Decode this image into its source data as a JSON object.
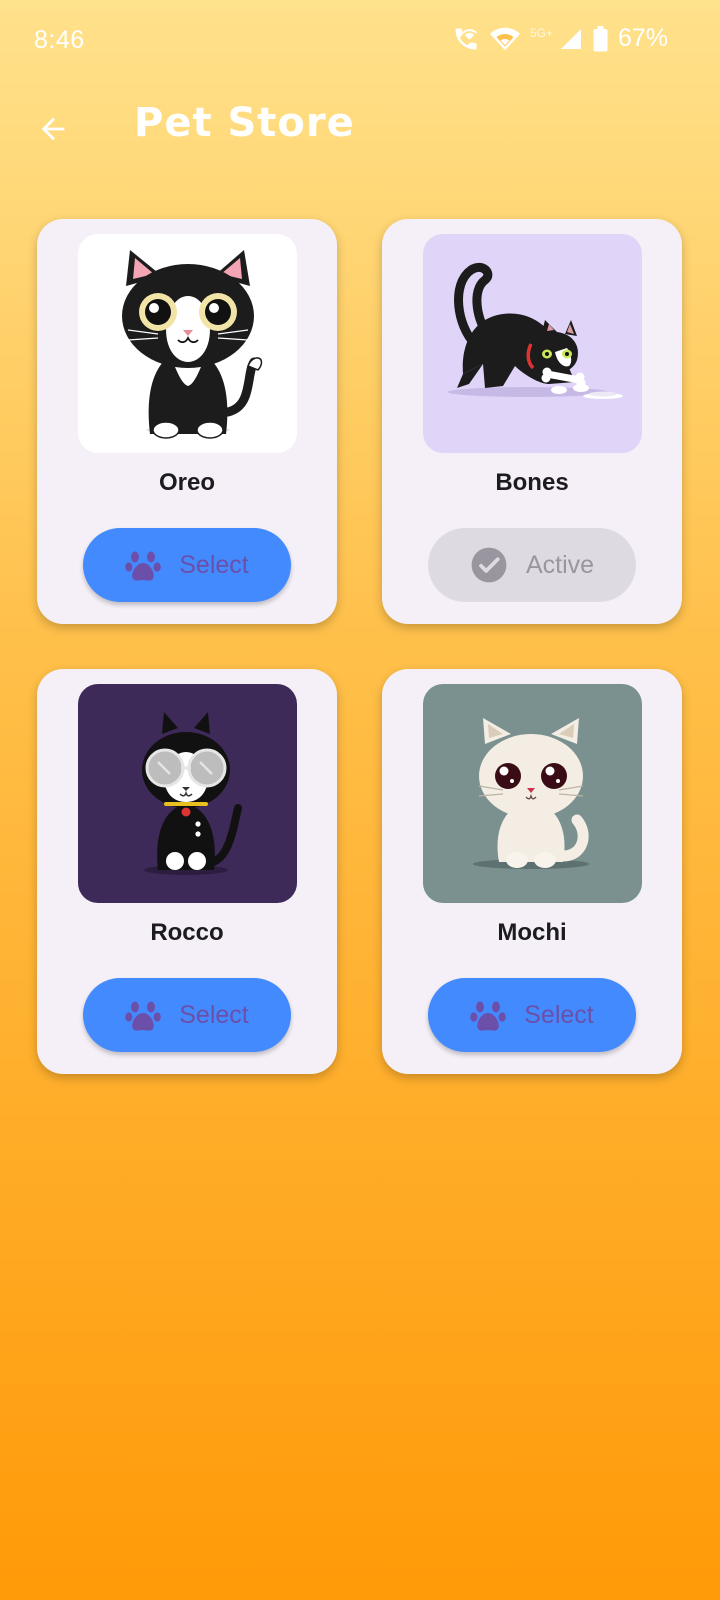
{
  "status_bar": {
    "time": "8:46",
    "network": "5G+",
    "battery": "67%",
    "icons": [
      "wifi-call-icon",
      "wifi-icon",
      "signal-icon",
      "battery-icon"
    ]
  },
  "app_bar": {
    "title": "Pet Store",
    "back_icon": "arrow-back-icon"
  },
  "pets": [
    {
      "name": "Oreo",
      "action": "Select",
      "state": "select",
      "image_bg": "#FFFFFF"
    },
    {
      "name": "Bones",
      "action": "Active",
      "state": "active",
      "image_bg": "#E0D4F8"
    },
    {
      "name": "Rocco",
      "action": "Select",
      "state": "select",
      "image_bg": "#3E2A58"
    },
    {
      "name": "Mochi",
      "action": "Select",
      "state": "select",
      "image_bg": "#7A9190"
    }
  ],
  "colors": {
    "background_top": "#FFE28C",
    "background_bottom": "#FF9A08",
    "card": "#F5F0F8",
    "select_button": "#448AFF",
    "select_label": "#6B4FA8",
    "active_button": "#DEDAE2",
    "active_label": "#9A96A0"
  }
}
